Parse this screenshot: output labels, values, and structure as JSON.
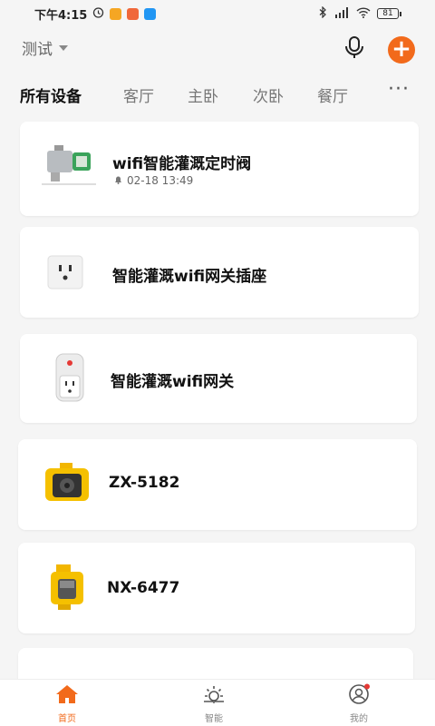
{
  "status_bar": {
    "time": "下午4:15",
    "battery": "81"
  },
  "header": {
    "home_name": "测试"
  },
  "tabs": [
    {
      "label": "所有设备",
      "active": true
    },
    {
      "label": "客厅"
    },
    {
      "label": "主卧"
    },
    {
      "label": "次卧"
    },
    {
      "label": "餐厅"
    }
  ],
  "devices": [
    {
      "name": "wifi智能灌溉定时阀",
      "subtitle": "02-18 13:49"
    },
    {
      "name": "智能灌溉wifi网关插座"
    },
    {
      "name": "智能灌溉wifi网关"
    },
    {
      "name": "ZX-5182"
    },
    {
      "name": "NX-6477"
    }
  ],
  "bottom_nav": [
    {
      "label": "首页",
      "active": true
    },
    {
      "label": "智能"
    },
    {
      "label": "我的"
    }
  ],
  "colors": {
    "accent": "#f26a1b",
    "notification_dot": "#e53935"
  },
  "icons": {
    "status": [
      "alarm-icon",
      "bluetooth-icon",
      "signal-icon",
      "wifi-icon",
      "battery-icon"
    ],
    "header": [
      "microphone-icon",
      "add-icon"
    ],
    "nav": [
      "home-icon",
      "sun-icon",
      "user-icon"
    ]
  }
}
